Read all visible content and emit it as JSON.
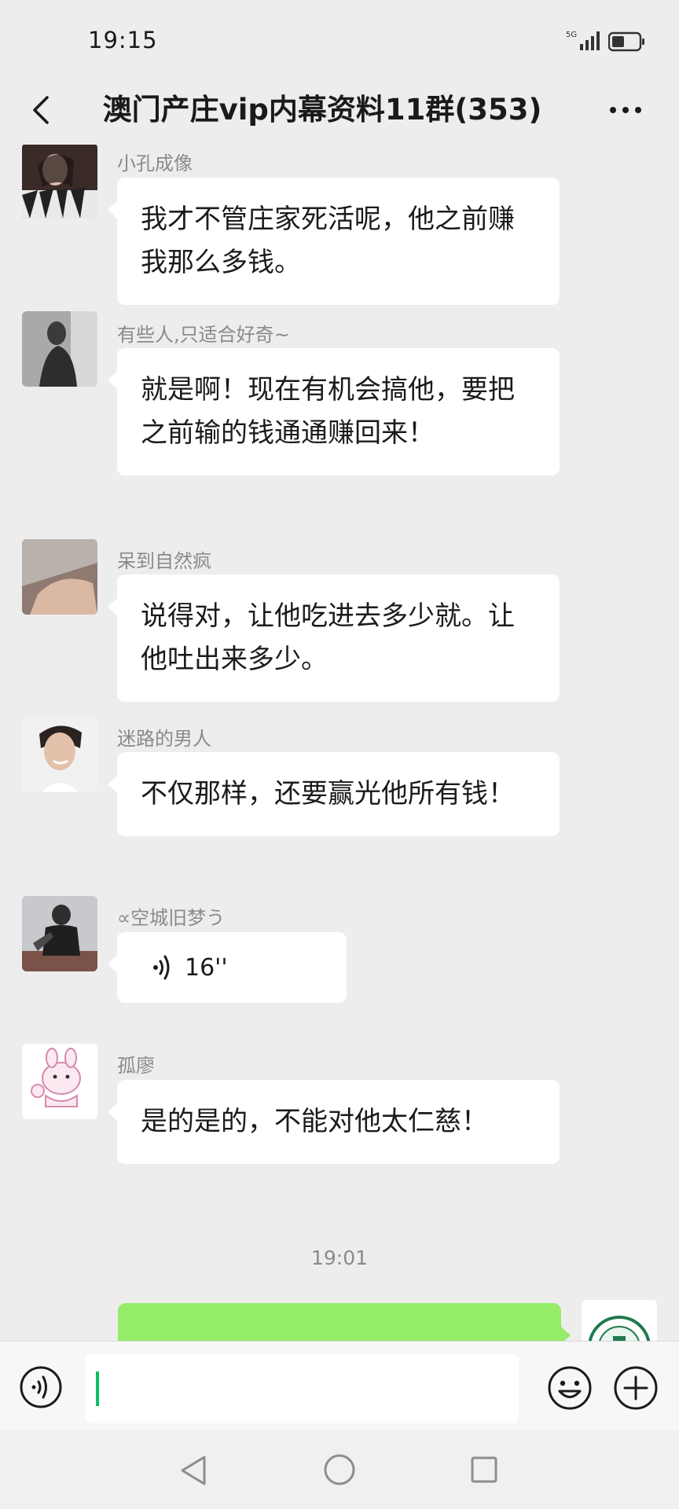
{
  "status_bar": {
    "time": "19:15",
    "network": "5G",
    "signal_icon": "signal-icon",
    "battery_icon": "battery-icon"
  },
  "header": {
    "title": "澳门产庄vip内幕资料11群(353)",
    "back_icon": "back-chevron-icon",
    "more_icon": "more-dots-icon"
  },
  "messages": [
    {
      "sender": "小孔成像",
      "text": "我才不管庄家死活呢，他之前赚我那么多钱。"
    },
    {
      "sender": "有些人,只适合好奇~",
      "text": "就是啊！现在有机会搞他，要把之前输的钱通通赚回来！"
    },
    {
      "sender": "呆到自然疯",
      "text": "说得对，让他吃进去多少就。让他吐出来多少。"
    },
    {
      "sender": "迷路的男人",
      "text": "不仅那样，还要赢光他所有钱！"
    },
    {
      "sender": "∝空城旧梦う",
      "voice_duration": "16''"
    },
    {
      "sender": "孤廖",
      "text": "是的是的，不能对他太仁慈！"
    }
  ],
  "time_divider": "19:01",
  "input_bar": {
    "voice_icon": "voice-mode-icon",
    "emoji_icon": "emoji-icon",
    "plus_icon": "plus-icon"
  },
  "nav_bar": {
    "back_icon": "nav-back-triangle-icon",
    "home_icon": "nav-home-circle-icon",
    "recent_icon": "nav-recent-square-icon"
  },
  "colors": {
    "background": "#ededed",
    "bubble_in": "#ffffff",
    "bubble_out": "#95ec69",
    "caret": "#07c160",
    "sender": "#8a8a8a"
  }
}
